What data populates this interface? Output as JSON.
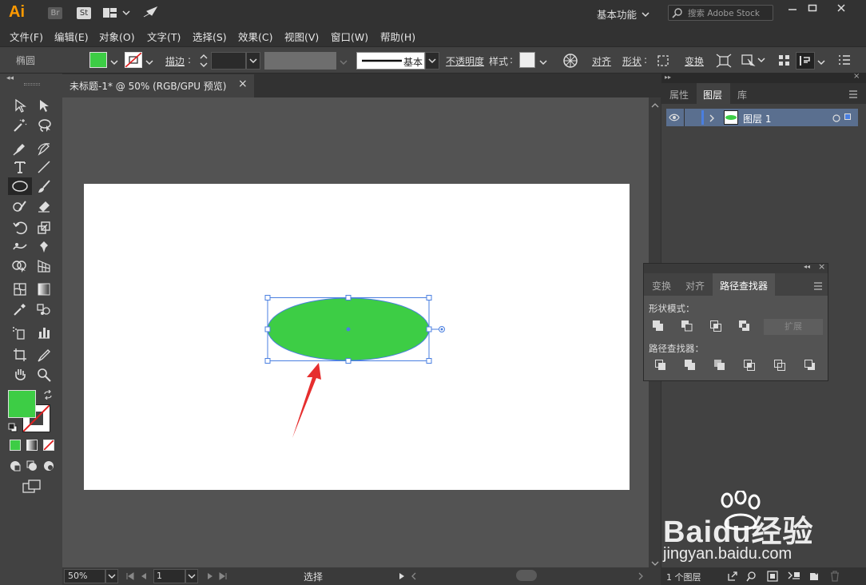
{
  "app": {
    "logo": "Ai",
    "br": "Br",
    "st": "St"
  },
  "titlebar": {
    "workspace": "基本功能",
    "search_placeholder": "搜索 Adobe Stock"
  },
  "menu": [
    "文件(F)",
    "编辑(E)",
    "对象(O)",
    "文字(T)",
    "选择(S)",
    "效果(C)",
    "视图(V)",
    "窗口(W)",
    "帮助(H)"
  ],
  "control": {
    "tool_name": "椭圆",
    "stroke_label": "描边",
    "stroke_profile": "基本",
    "opacity_label": "不透明度",
    "style_label": "样式",
    "align_label": "对齐",
    "shape_label": "形状",
    "transform_label": "变换"
  },
  "document": {
    "tab_title": "未标题-1* @ 50% (RGB/GPU 预览)",
    "close": "×"
  },
  "status": {
    "zoom": "50%",
    "page": "1",
    "mode": "选择"
  },
  "right_panel": {
    "tabs": [
      "属性",
      "图层",
      "库"
    ],
    "active_tab": "图层",
    "layer_name": "图层 1",
    "footer": "1 个图层"
  },
  "pathfinder": {
    "tabs": [
      "变换",
      "对齐",
      "路径查找器"
    ],
    "active_tab": "路径查找器",
    "shape_modes_label": "形状模式：",
    "expand_label": "扩展",
    "pathfinders_label": "路径查找器："
  },
  "watermark": {
    "brand": "Baidu经验",
    "url": "jingyan.baidu.com"
  },
  "colors": {
    "fill": "#3dcd45",
    "selection": "#4a7fe0",
    "arrow": "#e62e2e",
    "accent": "#1473e6"
  },
  "icons": [
    "selection-icon",
    "direct-selection-icon",
    "magic-wand-icon",
    "lasso-icon",
    "pen-icon",
    "curvature-icon",
    "type-icon",
    "line-icon",
    "ellipse-icon",
    "paintbrush-icon",
    "shaper-icon",
    "eraser-icon",
    "rotate-icon",
    "scale-icon",
    "warp-icon",
    "puppet-warp-icon",
    "shape-builder-icon",
    "perspective-icon",
    "mesh-icon",
    "gradient-icon",
    "eyedropper-icon",
    "blend-icon",
    "symbol-sprayer-icon",
    "graph-icon",
    "artboard-icon",
    "slice-icon",
    "hand-icon",
    "zoom-icon"
  ]
}
